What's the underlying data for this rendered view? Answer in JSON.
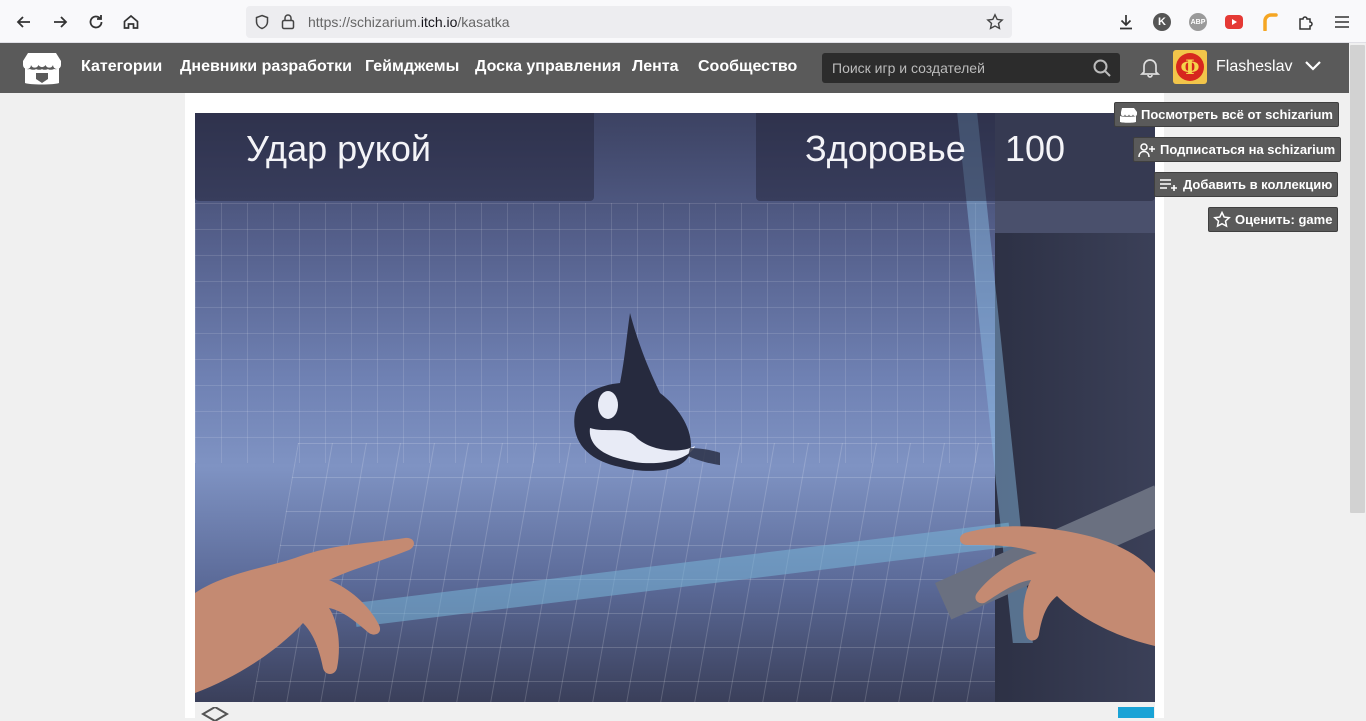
{
  "browser": {
    "url_prefix": "https://schizarium.",
    "url_host": "itch.io",
    "url_path": "/kasatka",
    "extensions": [
      "K",
      "ABP"
    ]
  },
  "header": {
    "nav": [
      {
        "label": "Категории"
      },
      {
        "label": "Дневники разработки"
      },
      {
        "label": "Геймджемы"
      },
      {
        "label": "Доска управления"
      },
      {
        "label": "Лента"
      },
      {
        "label": "Сообщество"
      }
    ],
    "search_placeholder": "Поиск игр и создателей",
    "username": "Flasheslav",
    "avatar_letter": "Ф"
  },
  "game": {
    "hud_left": "Удар рукой",
    "hud_health_label": "Здоровье",
    "hud_health_value": "100"
  },
  "actions": {
    "view_all": "Посмотреть всё от schizarium",
    "follow": "Подписаться на schizarium",
    "add_collection": "Добавить в коллекцию",
    "rate": "Оценить: game"
  },
  "colors": {
    "header_bg": "#5a5a5a",
    "accent": "#1aa3d6"
  }
}
